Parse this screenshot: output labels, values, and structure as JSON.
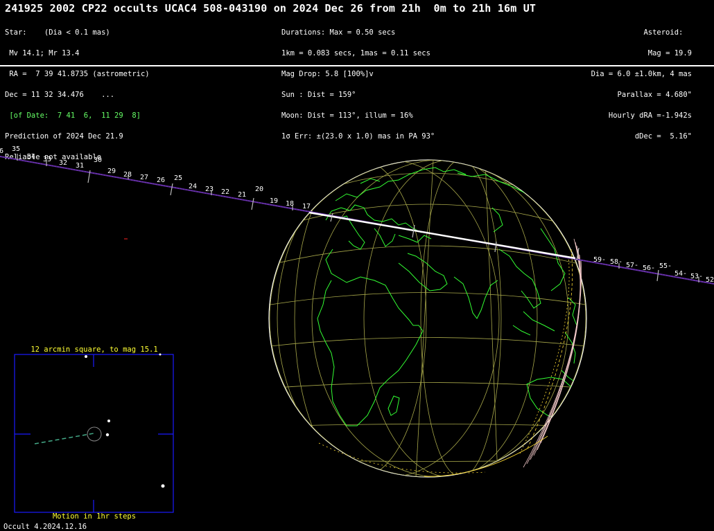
{
  "title": "241925 2002 CP22 occults UCAC4 508-043190 on 2024 Dec 26 from 21h  0m to 21h 16m UT",
  "star": {
    "l1": "Star:    (Dia < 0.1 mas)",
    "l2": " Mv 14.1; Mr 13.4",
    "l3": " RA =  7 39 41.8735 (astrometric)",
    "l4": "Dec = 11 32 34.476    ...",
    "l5": " [of Date:  7 41  6,  11 29  8]",
    "l6": "Prediction of 2024 Dec 21.9",
    "l7": "Reliable not available"
  },
  "event": {
    "l1": "Durations: Max = 0.50 secs",
    "l2": "1km = 0.083 secs, 1mas = 0.11 secs",
    "l3": "Mag Drop: 5.8 [100%]v",
    "l4": "Sun : Dist = 159°",
    "l5": "Moon: Dist = 113°, illum = 16%",
    "l6": "1σ Err: ±(23.0 x 1.0) mas in PA 93°"
  },
  "asteroid": {
    "l1": "Asteroid:  ",
    "l2": "Mag = 19.9",
    "l3": "Dia = 6.0 ±1.0km, 4 mas",
    "l4": "Parallax = 4.680\"",
    "l5": "Hourly dRA =-1.942s",
    "l6": "dDec =  5.16\""
  },
  "track_minutes_left": [
    "6",
    "35",
    "34",
    "33",
    "32",
    "31",
    "30",
    "29",
    "28",
    "27",
    "26",
    "25",
    "24",
    "23",
    "22",
    "21",
    "20",
    "19",
    "18",
    "17"
  ],
  "track_minutes_right": [
    "59-",
    "58-",
    "57-",
    "56-",
    "55-",
    "54-",
    "53-",
    "52"
  ],
  "finder": {
    "title": "12 arcmin square, to mag 15.1",
    "footer": "Motion in 1hr steps"
  },
  "version": "Occult 4.2024.12.16",
  "colors": {
    "background": "#000000",
    "coastline": "#33ff33",
    "graticule": "#a8a84a",
    "track": "#5a2a9a",
    "central_line": "#ffffff",
    "finder_box": "#1a1aff",
    "finder_text": "#ffff33",
    "limb": "#ffffff"
  }
}
